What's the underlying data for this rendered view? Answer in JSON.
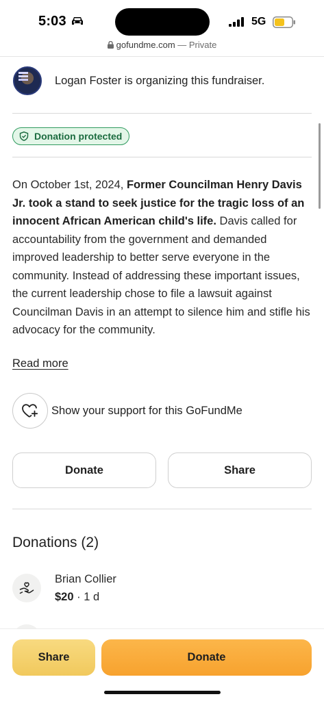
{
  "status_bar": {
    "time": "5:03",
    "network": "5G"
  },
  "url_bar": {
    "domain": "gofundme.com",
    "privacy": " — Private"
  },
  "organizer": {
    "text": "Logan Foster is organizing this fundraiser."
  },
  "badge": {
    "label": "Donation protected",
    "color": "#2f9a5e"
  },
  "story": {
    "intro": "On October 1st, 2024, ",
    "bold": "Former Councilman Henry Davis Jr. took a stand to seek justice for the tragic loss of an innocent African American child's life.",
    "body": " Davis called for accountability from the government and demanded improved leadership to better serve everyone in the community. Instead of addressing these important issues, the current leadership chose to file a lawsuit against Councilman Davis in an attempt to silence him and stifle his advocacy for the community.",
    "read_more": "Read more"
  },
  "support": {
    "label": "Show your support for this GoFundMe"
  },
  "actions": {
    "donate_label": "Donate",
    "share_label": "Share"
  },
  "donations": {
    "title": "Donations (2)",
    "items": [
      {
        "name": "Brian Collier",
        "amount": "$20",
        "time": " · 1 d"
      }
    ]
  },
  "bottom_bar": {
    "share_label": "Share",
    "donate_label": "Donate",
    "share_color": "#f4cf6a",
    "donate_color": "#f9ab3a"
  },
  "icons": {
    "car": "car-icon",
    "signal": "signal-icon",
    "battery": "battery-icon",
    "lock": "lock-icon",
    "shield": "shield-icon",
    "heart_plus": "heart-plus-icon",
    "hand_heart": "hand-heart-icon"
  }
}
